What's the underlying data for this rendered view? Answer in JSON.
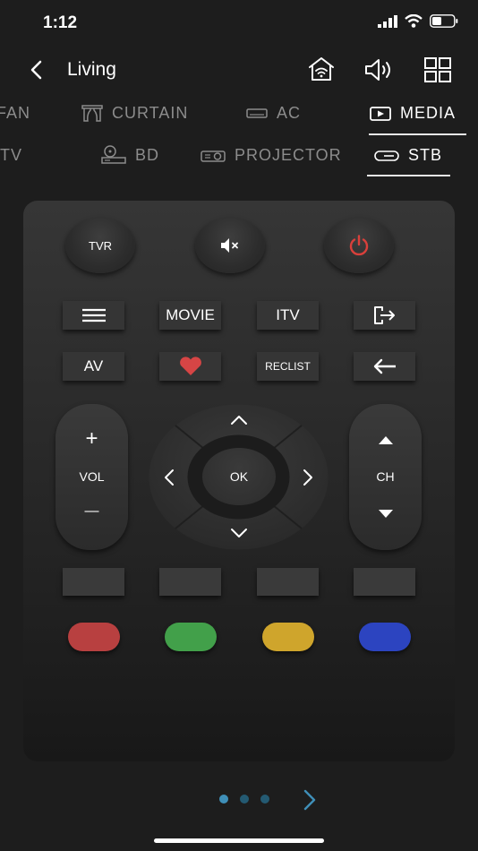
{
  "status": {
    "time": "1:12"
  },
  "header": {
    "title": "Living"
  },
  "tabs_row1": [
    {
      "label": "FAN",
      "icon": "fan-icon"
    },
    {
      "label": "CURTAIN",
      "icon": "curtain-icon"
    },
    {
      "label": "AC",
      "icon": "ac-icon"
    },
    {
      "label": "MEDIA",
      "icon": "media-icon",
      "active": true
    }
  ],
  "tabs_row2": [
    {
      "label": "TV",
      "icon": "tv-icon"
    },
    {
      "label": "BD",
      "icon": "bd-icon"
    },
    {
      "label": "PROJECTOR",
      "icon": "projector-icon"
    },
    {
      "label": "STB",
      "icon": "stb-icon",
      "active": true
    }
  ],
  "remote": {
    "tvr_label": "TVR",
    "movie_label": "MOVIE",
    "itv_label": "ITV",
    "av_label": "AV",
    "reclist_label": "RECLIST",
    "vol_label": "VOL",
    "vol_plus": "+",
    "vol_minus": "—",
    "ch_label": "CH",
    "ok_label": "OK"
  },
  "colors": {
    "power": "#d9403b",
    "heart": "#d64545",
    "red": "#b84040",
    "green": "#42a04a",
    "yellow": "#cfa52c",
    "blue": "#2c44c0",
    "page_dot_active": "#3f8fb8",
    "page_dot": "#245a72"
  },
  "pager": {
    "total": 3,
    "current": 1
  }
}
